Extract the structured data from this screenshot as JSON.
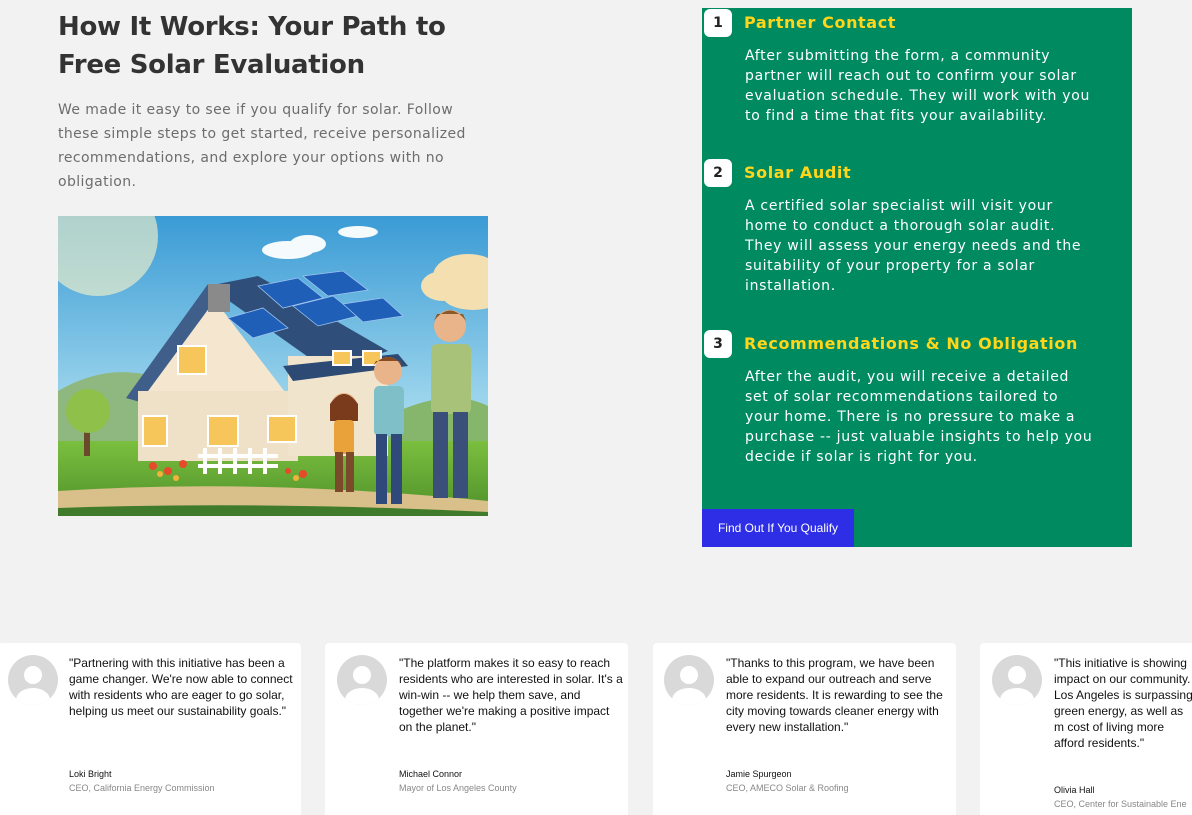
{
  "intro": {
    "title": "How It Works: Your Path to Free Solar Evaluation",
    "description": "We made it easy to see if you qualify for solar. Follow these simple steps to get started, receive personalized recommendations, and explore your options with no obligation."
  },
  "steps": [
    {
      "number": "1",
      "title": "Partner Contact",
      "description": "After submitting the form, a community partner will reach out to confirm your solar evaluation schedule. They will work with you to find a time that fits your availability."
    },
    {
      "number": "2",
      "title": "Solar Audit",
      "description": "A certified solar specialist will visit your home to conduct a thorough solar audit. They will assess your energy needs and the suitability of your property for a solar installation."
    },
    {
      "number": "3",
      "title": "Recommendations & No Obligation",
      "description": "After the audit, you will receive a detailed set of solar recommendations tailored to your home. There is no pressure to make a purchase -- just valuable insights to help you decide if solar is right for you."
    }
  ],
  "cta": {
    "label": "Find Out If You Qualify"
  },
  "testimonials": [
    {
      "quote": "\"Partnering with this initiative has been a game changer. We're now able to connect with residents who are eager to go solar, helping us meet our sustainability goals.\"",
      "name": "Loki Bright",
      "role": "CEO, California Energy Commission"
    },
    {
      "quote": "\"The platform makes it so easy to reach residents who are interested in solar. It's a win-win -- we help them save, and together we're making a positive impact on the planet.\"",
      "name": "Michael Connor",
      "role": "Mayor of Los Angeles County"
    },
    {
      "quote": "\"Thanks to this program, we have been able to expand our outreach and serve more residents. It is rewarding to see the city moving towards cleaner energy with every new installation.\"",
      "name": "Jamie Spurgeon",
      "role": "CEO, AMECO Solar & Roofing"
    },
    {
      "quote": "\"This initiative is showing impact on our community. Los Angeles is surpassing green energy, as well as m cost of living more afford residents.\"",
      "name": "Olivia Hall",
      "role": "CEO, Center for Sustainable Ene"
    }
  ],
  "colors": {
    "steps_bg": "#008a60",
    "step_title": "#ffd61a",
    "cta_bg": "#2e2ee6",
    "page_bg": "#f2f2f2"
  }
}
